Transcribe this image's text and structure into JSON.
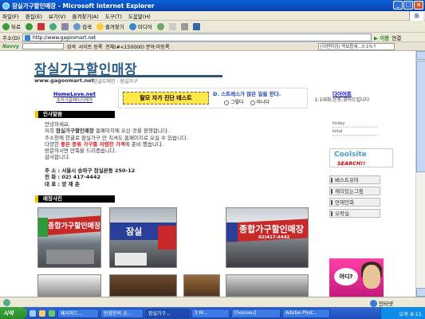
{
  "window": {
    "title": "잠실가구할인매장 - Microsoft Internet Explorer"
  },
  "menubar": [
    "파일(F)",
    "편집(E)",
    "보기(V)",
    "즐겨찾기(A)",
    "도구(T)",
    "도움말(H)"
  ],
  "toolbar": {
    "back": "뒤로",
    "search": "검색",
    "favorites": "즐겨찾기",
    "media": "미디어"
  },
  "address": {
    "label": "주소(D)",
    "url": "http://www.gagoomart.net",
    "go": "이동",
    "links": "연결"
  },
  "naver": {
    "logo": "Navvy",
    "search": "검색",
    "register": "사이트 등록",
    "count": "전체(#<150000) 분야:미등록",
    "ticker": "[이번마감] 약보합세...0.1%↑"
  },
  "site": {
    "title": "잠실가구할인매장",
    "url": "www.gagoomart.net",
    "crumb": "한글도메인 : 잠실가구",
    "homelove": {
      "title": "HomeLove.net",
      "sub": "초저가홈페이지제작"
    },
    "diag": {
      "button": "탈모 자가 진단 테스트",
      "question": "D. 스트레스가 많은 일을 한다.",
      "yes": "그렇다",
      "no": "아니다"
    },
    "diet": {
      "title": "다이어트",
      "sub": "1:1대화,운동,찾아드립니다"
    },
    "greeting_header": "인사말씀",
    "greeting": {
      "l1": "안녕하세요.",
      "l2a": "저희 ",
      "l2b": "잠실가구할인매장",
      "l2c": " 홈페이지에 오신 것을 환영합니다.",
      "l3": "주소창에 한글로 잠실가구 만 치셔도 홈페이지로 오실 수 있습니다.",
      "l4a": "다양한 ",
      "l4b": "좋은 종류 가구를 저렴한 가격",
      "l4c": "에 준비 했습니다.",
      "l5": "방문하시면 만족을 드리겠습니다.",
      "l6": "감사합니다."
    },
    "address_info": {
      "addr": "주  소 : 서울시 송파구 잠실본동 250-12",
      "tel": "전  화 : 02) 417-4442",
      "ceo": "대  표 : 양 재 춘"
    },
    "photos_header": "매장사진",
    "signs": {
      "big": "종합가구할인매장",
      "jamsil": "잠실",
      "phone": "02)417-4442"
    }
  },
  "sidebar": {
    "today": "today",
    "total": "total",
    "coolsite": "Coolsite",
    "searchlink": "SEARCH!!",
    "menus": [
      "베스트유머",
      "재미있는그림",
      "연재만화",
      "오락실"
    ],
    "ad_text": "어디?"
  },
  "status": {
    "zone": "인터넷"
  },
  "taskbar": {
    "start": "시작",
    "items": [
      "페이퍼드...",
      "한영한의 공...",
      "잠실가구...",
      "3 M...",
      "[hooneu]",
      "Adobe Phot..."
    ],
    "clock": "오후 8:11"
  },
  "colors": {
    "title_blue": "#2a5e88",
    "highlight_yellow": "#ffe74a",
    "taskbar_blue": "#3168d5"
  }
}
